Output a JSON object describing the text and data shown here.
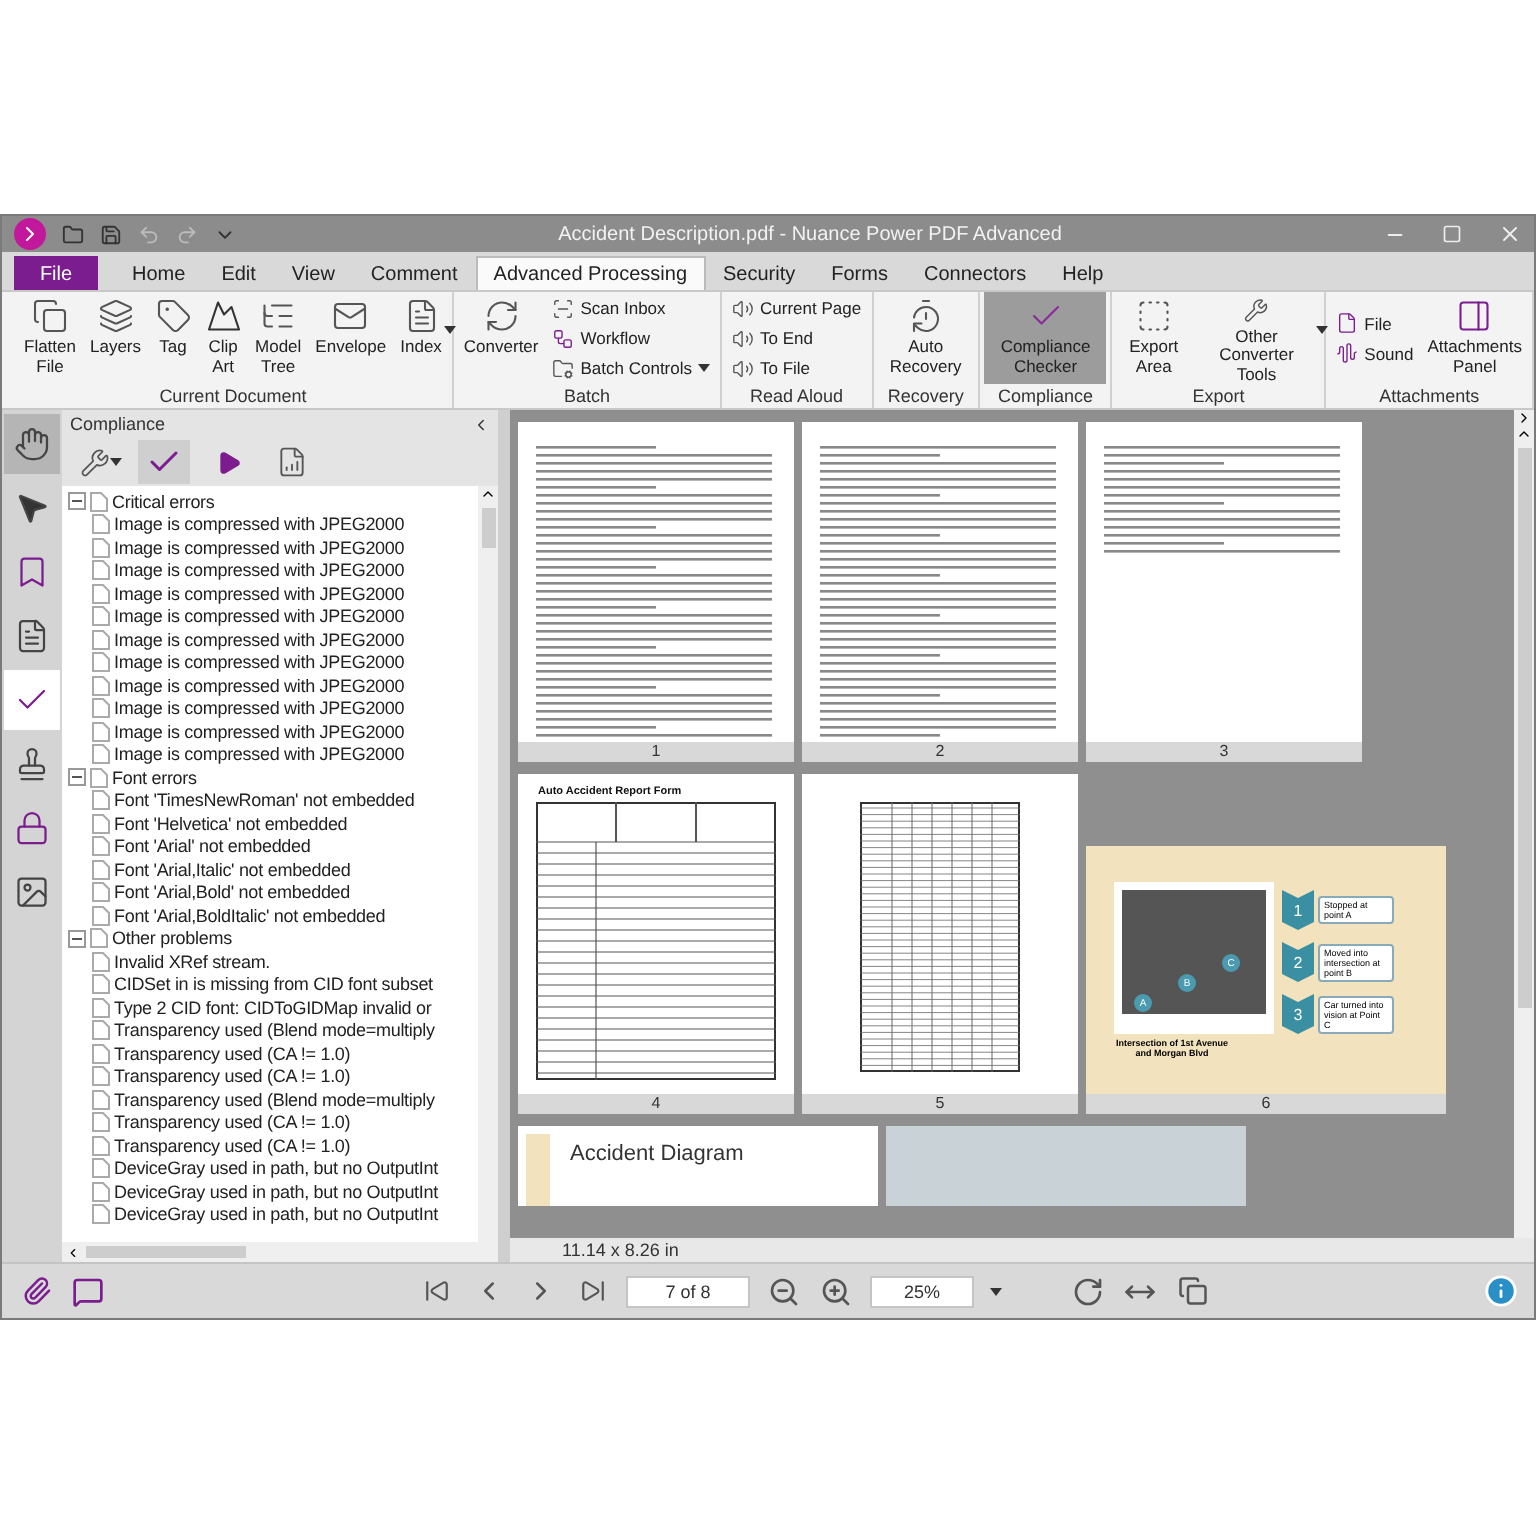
{
  "window": {
    "title": "Accident Description.pdf - Nuance Power PDF Advanced"
  },
  "menu_tabs": [
    {
      "label": "File",
      "kind": "file",
      "selected": false
    },
    {
      "label": "Home",
      "kind": "tab",
      "selected": false
    },
    {
      "label": "Edit",
      "kind": "tab",
      "selected": false
    },
    {
      "label": "View",
      "kind": "tab",
      "selected": false
    },
    {
      "label": "Comment",
      "kind": "tab",
      "selected": false
    },
    {
      "label": "Advanced Processing",
      "kind": "tab",
      "selected": true
    },
    {
      "label": "Security",
      "kind": "tab",
      "selected": false
    },
    {
      "label": "Forms",
      "kind": "tab",
      "selected": false
    },
    {
      "label": "Connectors",
      "kind": "tab",
      "selected": false
    },
    {
      "label": "Help",
      "kind": "tab",
      "selected": false
    }
  ],
  "ribbon": [
    {
      "label": "Current Document",
      "items": [
        {
          "label": "Flatten File",
          "kind": "large",
          "selected": false
        },
        {
          "label": "Layers",
          "kind": "large",
          "selected": false
        },
        {
          "label": "Tag",
          "kind": "large",
          "selected": false
        },
        {
          "label": "Clip Art",
          "kind": "large",
          "selected": false
        },
        {
          "label": "Model Tree",
          "kind": "large",
          "selected": false
        },
        {
          "label": "Envelope",
          "kind": "large",
          "selected": false
        },
        {
          "label": "Index",
          "kind": "large",
          "selected": false,
          "caret": true
        }
      ]
    },
    {
      "label": "Batch",
      "items": [
        {
          "label": "Converter",
          "kind": "large",
          "selected": false
        },
        {
          "label": "Scan Inbox",
          "kind": "small",
          "selected": false
        },
        {
          "label": "Workflow",
          "kind": "small",
          "selected": false
        },
        {
          "label": "Batch Controls",
          "kind": "small",
          "selected": false,
          "caret": true
        }
      ]
    },
    {
      "label": "Read Aloud",
      "items": [
        {
          "label": "Current Page",
          "kind": "small",
          "selected": false
        },
        {
          "label": "To End",
          "kind": "small",
          "selected": false
        },
        {
          "label": "To File",
          "kind": "small",
          "selected": false
        }
      ]
    },
    {
      "label": "Recovery",
      "items": [
        {
          "label": "Auto Recovery",
          "kind": "large",
          "selected": false
        }
      ]
    },
    {
      "label": "Compliance",
      "items": [
        {
          "label": "Compliance Checker",
          "kind": "large",
          "selected": true
        }
      ]
    },
    {
      "label": "Export",
      "items": [
        {
          "label": "Export Area",
          "kind": "large",
          "selected": false
        },
        {
          "label": "Other Converter Tools",
          "kind": "large",
          "selected": false,
          "caret": true
        }
      ]
    },
    {
      "label": "Attachments",
      "items": [
        {
          "label": "File",
          "kind": "small",
          "selected": false
        },
        {
          "label": "Sound",
          "kind": "small",
          "selected": false
        },
        {
          "label": "Attachments Panel",
          "kind": "large",
          "selected": false
        }
      ]
    }
  ],
  "side_tools": [
    {
      "selected": true
    },
    {
      "selected": false
    },
    {
      "selected": false
    },
    {
      "selected": false
    },
    {
      "selected": true
    },
    {
      "selected": false
    },
    {
      "selected": false
    },
    {
      "selected": false
    }
  ],
  "panel": {
    "title": "Compliance",
    "tree": [
      {
        "label": "Critical errors",
        "expanded": true,
        "children": [
          {
            "label": "Image is compressed with JPEG2000"
          },
          {
            "label": "Image is compressed with JPEG2000"
          },
          {
            "label": "Image is compressed with JPEG2000"
          },
          {
            "label": "Image is compressed with JPEG2000"
          },
          {
            "label": "Image is compressed with JPEG2000"
          },
          {
            "label": "Image is compressed with JPEG2000"
          },
          {
            "label": "Image is compressed with JPEG2000"
          },
          {
            "label": "Image is compressed with JPEG2000"
          },
          {
            "label": "Image is compressed with JPEG2000"
          },
          {
            "label": "Image is compressed with JPEG2000"
          },
          {
            "label": "Image is compressed with JPEG2000"
          }
        ]
      },
      {
        "label": "Font errors",
        "expanded": true,
        "children": [
          {
            "label": "Font  'TimesNewRoman' not embedded"
          },
          {
            "label": "Font  'Helvetica' not embedded"
          },
          {
            "label": "Font  'Arial' not embedded"
          },
          {
            "label": "Font  'Arial,Italic' not embedded"
          },
          {
            "label": "Font  'Arial,Bold' not embedded"
          },
          {
            "label": "Font  'Arial,BoldItalic' not embedded"
          }
        ]
      },
      {
        "label": "Other problems",
        "expanded": true,
        "children": [
          {
            "label": "Invalid XRef stream."
          },
          {
            "label": "CIDSet in is missing from CID font subset"
          },
          {
            "label": "Type 2 CID font: CIDToGIDMap invalid or"
          },
          {
            "label": "Transparency used (Blend mode=multiply"
          },
          {
            "label": "Transparency used (CA != 1.0)"
          },
          {
            "label": "Transparency used (CA != 1.0)"
          },
          {
            "label": "Transparency used (Blend mode=multiply"
          },
          {
            "label": "Transparency used (CA != 1.0)"
          },
          {
            "label": "Transparency used (CA != 1.0)"
          },
          {
            "label": "DeviceGray used in path, but no OutputInt"
          },
          {
            "label": "DeviceGray used in path, but no OutputInt"
          },
          {
            "label": "DeviceGray used in path, but no OutputInt"
          }
        ]
      }
    ]
  },
  "pages": [
    {
      "number": "1",
      "kind": "letter"
    },
    {
      "number": "2",
      "kind": "letter"
    },
    {
      "number": "3",
      "kind": "short"
    },
    {
      "number": "4",
      "kind": "form",
      "title": "Auto Accident Report Form"
    },
    {
      "number": "5",
      "kind": "table"
    },
    {
      "number": "6",
      "kind": "slide",
      "caption": "Intersection of 1st Avenue and Morgan Blvd",
      "markers": [
        "A",
        "B",
        "C"
      ],
      "steps": [
        {
          "number": "1",
          "text": "Stopped at point A"
        },
        {
          "number": "2",
          "text": "Moved into intersection at point B"
        },
        {
          "number": "3",
          "text": "Car turned into vision at Point C"
        }
      ]
    },
    {
      "kind": "diagram",
      "title": "Accident Diagram"
    },
    {
      "kind": "photo"
    }
  ],
  "page_size": "11.14 x 8.26 in",
  "page_field": "7 of 8",
  "zoom": "25%"
}
